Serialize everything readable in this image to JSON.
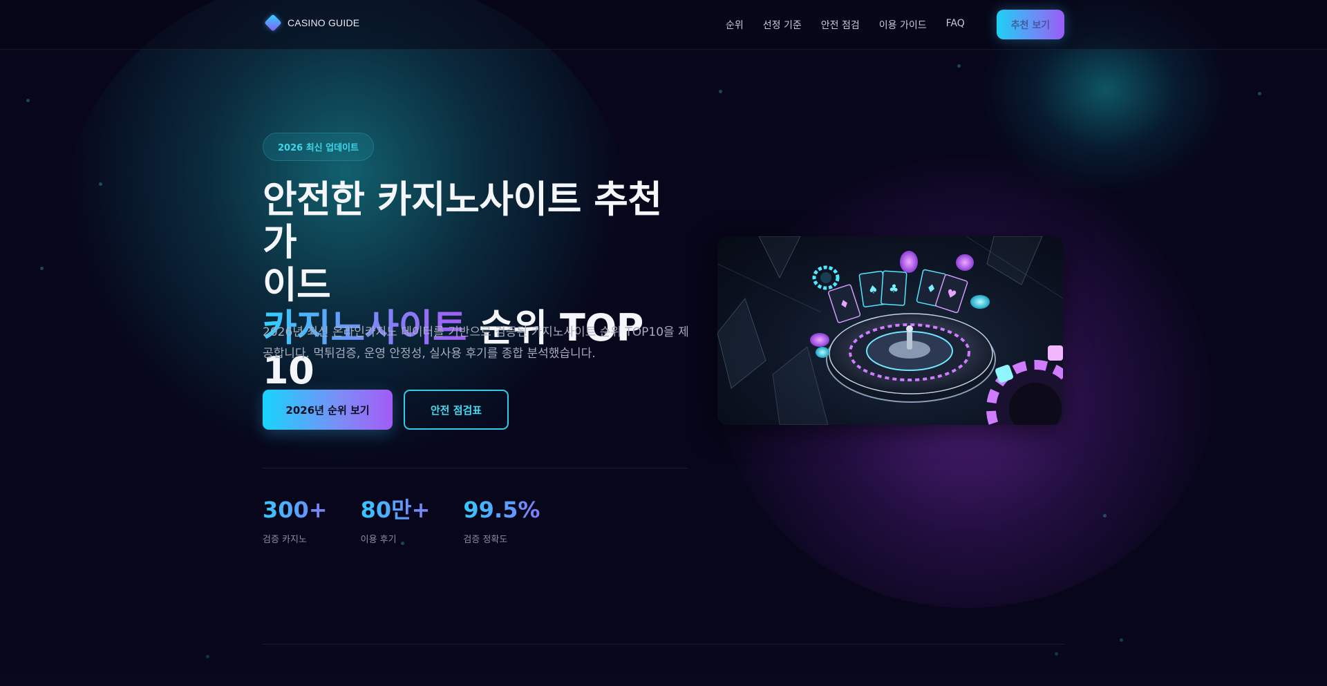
{
  "nav": {
    "logo_text": "CASINO GUIDE",
    "links": [
      "순위",
      "선정 기준",
      "안전 점검",
      "이용 가이드",
      "FAQ"
    ],
    "cta_label": "추천 보기"
  },
  "hero": {
    "badge": "2026 최신 업데이트",
    "headline_line1": "안전한 카지노사이트 추천 가",
    "headline_line2": "이드",
    "headline_highlight": "카지노사이트",
    "headline_rest": " 순위 TOP 10",
    "subtitle": "2026년 최신 온라인카지노 데이터를 기반으로 검증된 카지노사이트 순위 TOP10을 제공합니다. 먹튀검증, 운영 안정성, 실사용 후기를 종합 분석했습니다.",
    "primary_button": "2026년 순위 보기",
    "secondary_button": "안전 점검표"
  },
  "stats": [
    {
      "value": "300+",
      "label": "검증 카지노"
    },
    {
      "value": "80만+",
      "label": "이용 후기"
    },
    {
      "value": "99.5%",
      "label": "검증 정확도"
    }
  ],
  "colors": {
    "background": "#07061a",
    "accent_cyan": "#18d4fb",
    "accent_purple": "#a35bf7"
  },
  "icons": {
    "logo": "diamond-logo-icon",
    "badge": "sparkle-icon",
    "primary_button": "trophy-icon",
    "secondary_button": "shield-icon"
  }
}
